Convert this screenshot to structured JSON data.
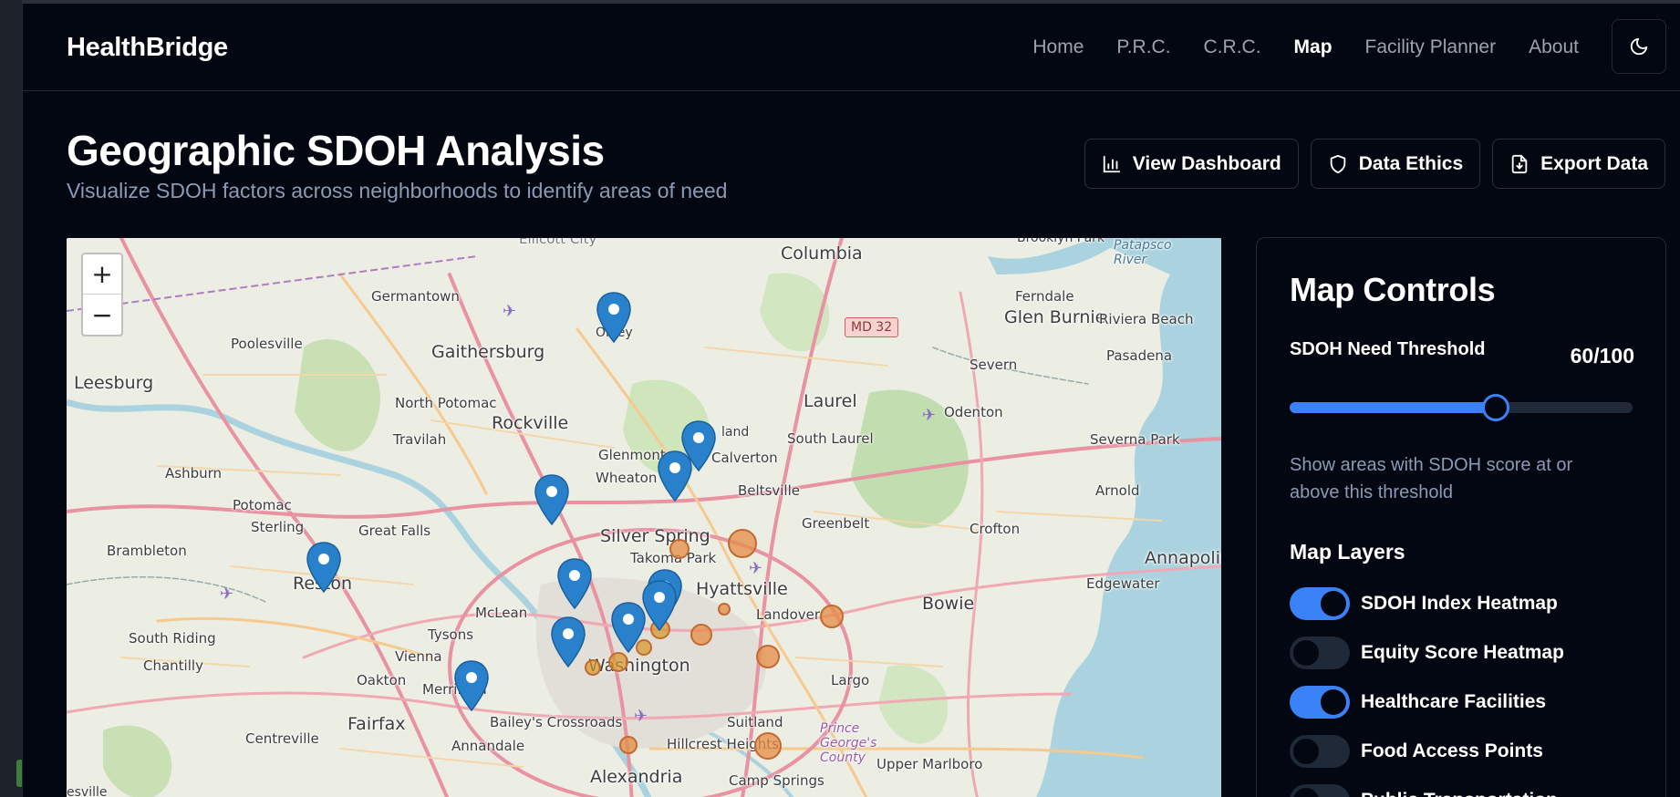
{
  "nav": {
    "brand": "HealthBridge",
    "links": [
      "Home",
      "P.R.C.",
      "C.R.C.",
      "Map",
      "Facility Planner",
      "About"
    ],
    "active": "Map",
    "theme_icon": "moon-icon"
  },
  "header": {
    "title": "Geographic SDOH Analysis",
    "subtitle": "Visualize SDOH factors across neighborhoods to identify areas of need",
    "buttons": [
      {
        "label": "View Dashboard",
        "icon": "bar-chart-icon"
      },
      {
        "label": "Data Ethics",
        "icon": "shield-icon"
      },
      {
        "label": "Export Data",
        "icon": "file-download-icon"
      }
    ]
  },
  "map": {
    "zoom_in": "+",
    "zoom_out": "−",
    "route_shield": "MD 32",
    "places": [
      "Columbia",
      "Germantown",
      "Gaithersburg",
      "Poolesville",
      "Leesburg",
      "Olney",
      "Glen Burnie",
      "Riviera Beach",
      "Ferndale",
      "Pasadena",
      "Severn",
      "Odenton",
      "Laurel",
      "North Potomac",
      "Rockville",
      "Travilah",
      "Glenmont",
      "Wheaton",
      "South Laurel",
      "Calverton",
      "Beltsville",
      "Ashburn",
      "Potomac",
      "Sterling",
      "Great Falls",
      "Silver Spring",
      "Greenbelt",
      "Takoma Park",
      "Brambleton",
      "Reston",
      "Hyattsville",
      "McLean",
      "Landover",
      "Bowie",
      "South Riding",
      "Tysons",
      "Vienna",
      "Washington",
      "Chantilly",
      "Oakton",
      "Merrifield",
      "Fairfax",
      "Largo",
      "Bailey's Crossroads",
      "Suitland",
      "Centreville",
      "Annandale",
      "Hillcrest Heights",
      "Prince George's County",
      "Alexandria",
      "Camp Springs",
      "Upper Marlboro",
      "Crofton",
      "Arnold",
      "Severna Park",
      "Annapolis",
      "Edgewater",
      "Patapsco River",
      "Brooklyn Park",
      "Ellicott City",
      "land",
      "esville"
    ],
    "facility_markers": 13,
    "need_circles": 13
  },
  "controls": {
    "title": "Map Controls",
    "threshold_label": "SDOH Need Threshold",
    "threshold_value": "60/100",
    "threshold_fraction": 0.6,
    "threshold_help": "Show areas with SDOH score at or above this threshold",
    "layers_title": "Map Layers",
    "layers": [
      {
        "label": "SDOH Index Heatmap",
        "on": true
      },
      {
        "label": "Equity Score Heatmap",
        "on": false
      },
      {
        "label": "Healthcare Facilities",
        "on": true
      },
      {
        "label": "Food Access Points",
        "on": false
      },
      {
        "label": "Public Transportation",
        "on": false
      }
    ]
  },
  "colors": {
    "background": "#030712",
    "accent": "#3b82f6",
    "muted_text": "#8b9bb4",
    "border": "#1f2937",
    "need_circle": "#e68c46",
    "marker": "#2a81cb"
  }
}
